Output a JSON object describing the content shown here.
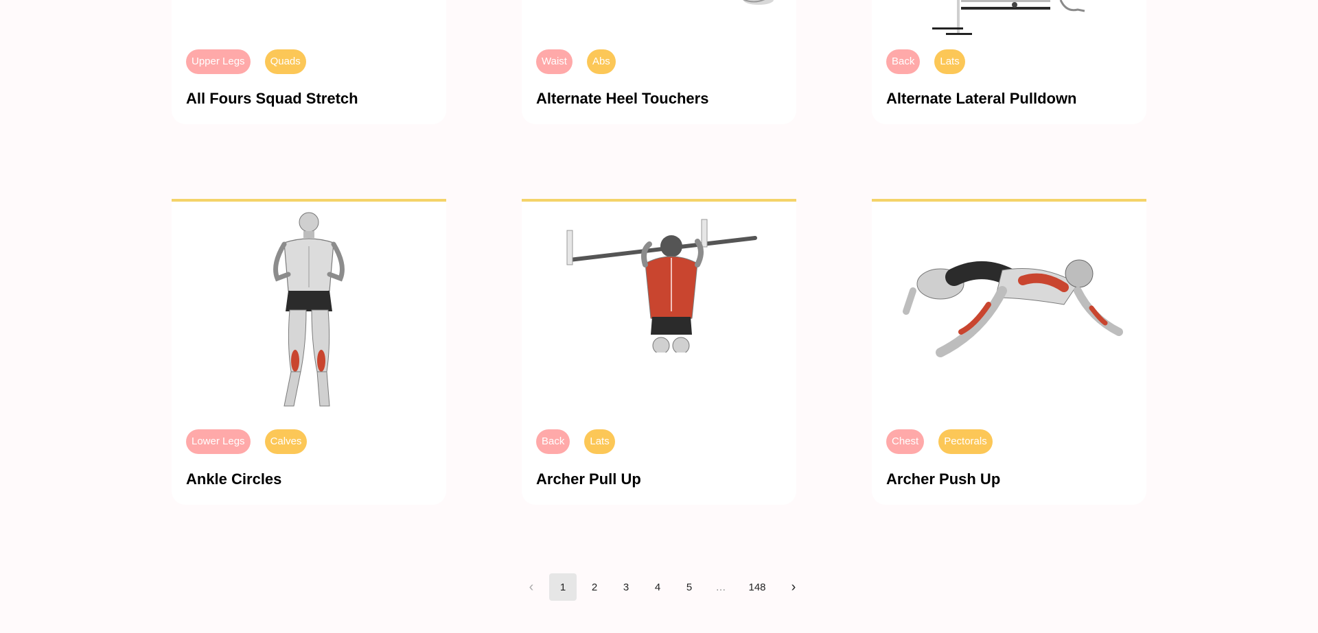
{
  "cards": [
    {
      "body_part": "Upper Legs",
      "target": "Quads",
      "title": "All Fours Squad Stretch"
    },
    {
      "body_part": "Waist",
      "target": "Abs",
      "title": "Alternate Heel Touchers"
    },
    {
      "body_part": "Back",
      "target": "Lats",
      "title": "Alternate Lateral Pulldown"
    },
    {
      "body_part": "Lower Legs",
      "target": "Calves",
      "title": "Ankle Circles"
    },
    {
      "body_part": "Back",
      "target": "Lats",
      "title": "Archer Pull Up"
    },
    {
      "body_part": "Chest",
      "target": "Pectorals",
      "title": "Archer Push Up"
    }
  ],
  "pagination": {
    "pages": [
      "1",
      "2",
      "3",
      "4",
      "5"
    ],
    "ellipsis": "…",
    "last": "148",
    "current": "1"
  },
  "colors": {
    "body_tag": "#ffa9a9",
    "target_tag": "#fcc757",
    "card_accent": "#f4d369",
    "page_bg": "#fffafb"
  }
}
